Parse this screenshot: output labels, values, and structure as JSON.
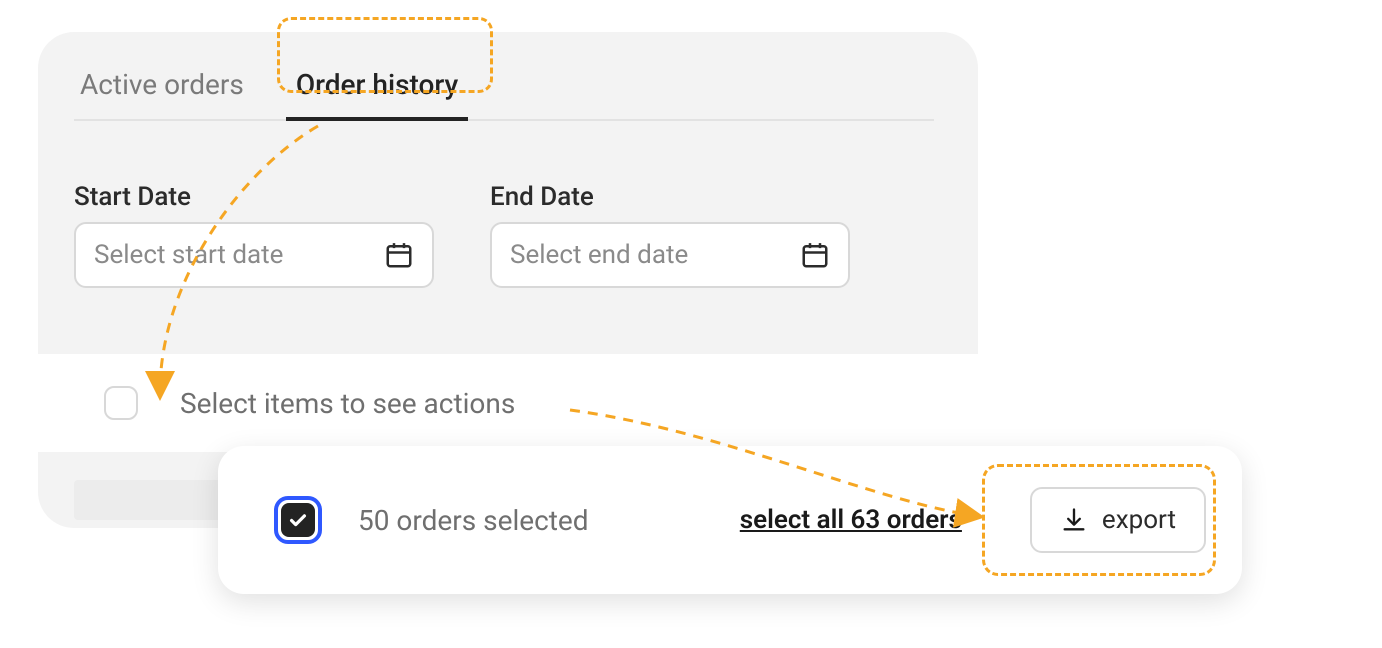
{
  "tabs": {
    "active_orders": "Active orders",
    "order_history": "Order history"
  },
  "date": {
    "start_label": "Start Date",
    "start_placeholder": "Select start date",
    "end_label": "End Date",
    "end_placeholder": "Select end date"
  },
  "select_row": {
    "prompt": "Select items to see actions"
  },
  "selection": {
    "count_text": "50 orders selected",
    "select_all_text": "select all 63 orders",
    "export_label": "export"
  },
  "annotation": {
    "color": "#f5a623"
  }
}
